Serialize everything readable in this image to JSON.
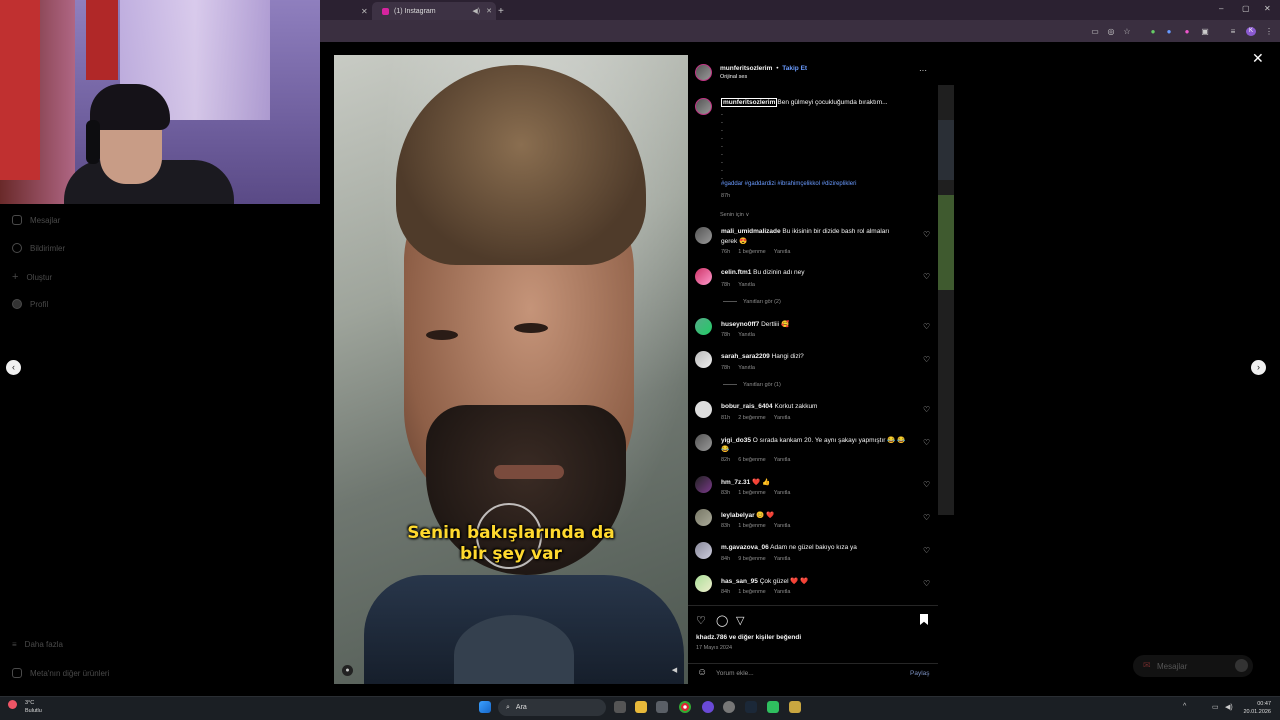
{
  "browser": {
    "tab_title": "(1) Instagram",
    "window_controls": [
      "–",
      "▢",
      "✕"
    ],
    "new_tab": "+"
  },
  "left_nav": {
    "items": [
      {
        "label": "Mesajlar",
        "icon": "message-icon"
      },
      {
        "label": "Bildirimler",
        "icon": "heart-icon"
      },
      {
        "label": "Oluştur",
        "icon": "plus-icon"
      },
      {
        "label": "Profil",
        "icon": "avatar-icon"
      }
    ],
    "bottom_items": [
      {
        "label": "Daha fazla",
        "icon": "menu-icon"
      },
      {
        "label": "Meta'nın diğer ürünleri",
        "icon": "meta-icon"
      }
    ]
  },
  "video": {
    "subtitle_line1": "Senin bakışlarında da",
    "subtitle_line2": "bir şey var"
  },
  "post": {
    "author": "munferitsozlerim",
    "separator": "•",
    "follow_label": "Takip Et",
    "audio": "Orijinal ses",
    "more_label": "···",
    "caption_author": "munferitsozlerim",
    "caption_text": "Ben gülmeyi çocukluğumda bıraktım...",
    "hashtags": "#gaddar #gaddardizi #ibrahimçelikkol #dizireplikleri",
    "caption_age": "87h",
    "section_label": "Senin için ∨",
    "likes_text": "khadz.786 ve diğer kişiler beğendi",
    "date": "17 Mayıs 2024",
    "comment_placeholder": "Yorum ekle...",
    "share_label": "Paylaş"
  },
  "comments": [
    {
      "user": "mali_umidmalizade",
      "text": "Bu ikisinin bir dizide bash rol almaları",
      "text2": "gerek 😍",
      "age": "76h",
      "likes": "1 beğenme",
      "reply": "Yanıtla"
    },
    {
      "user": "celin.ftm1",
      "text": "Bu dizinin adı ney",
      "age": "78h",
      "likes": "",
      "reply": "Yanıtla",
      "view_replies": "Yanıtları gör (2)"
    },
    {
      "user": "huseyno0ff7",
      "text": "Dertliii 🥰",
      "age": "78h",
      "likes": "",
      "reply": "Yanıtla"
    },
    {
      "user": "sarah_sara2209",
      "text": "Hangi dizi?",
      "age": "78h",
      "likes": "",
      "reply": "Yanıtla",
      "view_replies": "Yanıtları gör (1)"
    },
    {
      "user": "bobur_rais_6404",
      "text": "Korkut zakkum",
      "age": "81h",
      "likes": "2 beğenme",
      "reply": "Yanıtla"
    },
    {
      "user": "yigi_do35",
      "text": "O sırada kankam 20. Ye aynı şakayı yapmıştır 😂 😂",
      "text2": "😂",
      "age": "82h",
      "likes": "6 beğenme",
      "reply": "Yanıtla"
    },
    {
      "user": "hm_7z.31",
      "text": "❤️ 👍",
      "age": "83h",
      "likes": "1 beğenme",
      "reply": "Yanıtla"
    },
    {
      "user": "leylabelyar",
      "text": "😊 ❤️",
      "age": "83h",
      "likes": "1 beğenme",
      "reply": "Yanıtla"
    },
    {
      "user": "m.gavazova_06",
      "text": "Adam ne güzel bakıyo kıza ya",
      "age": "84h",
      "likes": "9 beğenme",
      "reply": "Yanıtla"
    },
    {
      "user": "has_san_95",
      "text": "Çok güzel ❤️ ❤️",
      "age": "84h",
      "likes": "1 beğenme",
      "reply": "Yanıtla"
    }
  ],
  "messages_pill": "Mesajlar",
  "taskbar": {
    "weather_temp": "3°C",
    "weather_desc": "Bulutlu",
    "search_placeholder": "Ara",
    "time": "00:47",
    "date": "20.01.2026"
  },
  "colors": {
    "accent_link": "#6a9bff",
    "subtitle": "#ffd92e",
    "tab_bar": "#2b2131"
  }
}
